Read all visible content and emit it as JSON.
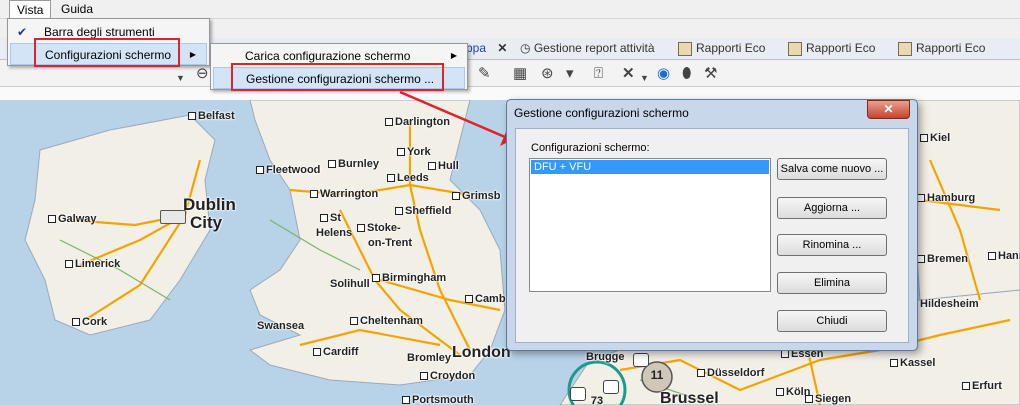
{
  "menubar": {
    "items": [
      "Vista",
      "Guida"
    ]
  },
  "vista_menu": {
    "items": [
      {
        "label": "Barra degli strumenti",
        "checked": true
      },
      {
        "label": "Configurazioni schermo",
        "has_submenu": true
      }
    ]
  },
  "submenu": {
    "items": [
      {
        "label": "Carica configurazione schermo",
        "has_submenu": true
      },
      {
        "label": "Gestione configurazioni schermo ..."
      }
    ]
  },
  "tabs": {
    "partial_label": "ppa",
    "report_label": "Gestione report attività",
    "eco1": "Rapporti Eco",
    "eco2": "Rapporti Eco",
    "eco3": "Rapporti Eco"
  },
  "dialog": {
    "title": "Gestione configurazioni schermo",
    "list_label": "Configurazioni schermo:",
    "configs": [
      "DFU + VFU"
    ],
    "buttons": {
      "save_new": "Salva come nuovo ...",
      "update": "Aggiorna ...",
      "rename": "Rinomina ...",
      "delete": "Elimina",
      "close": "Chiudi"
    }
  },
  "map": {
    "cities": [
      "Belfast",
      "Darlington",
      "Fleetwood",
      "Burnley",
      "York",
      "Hull",
      "Dublin",
      "City",
      "Warrington",
      "Leeds",
      "Grimsb",
      "Galway",
      "Sheffield",
      "St",
      "Helens",
      "Stoke-",
      "on-Trent",
      "Limerick",
      "Birmingham",
      "Solihull",
      "Camb",
      "Cork",
      "Swansea",
      "Cheltenham",
      "Cardiff",
      "Bromley",
      "London",
      "Croydon",
      "Portsmouth",
      "Brugge",
      "Essen",
      "Düsseldorf",
      "Kassel",
      "Brussel",
      "Köln",
      "Siegen",
      "Hamburg",
      "Bremen",
      "Hildesheim",
      "Hannover",
      "Kiel",
      "Erfurt"
    ],
    "markers": {
      "cluster_11": "11",
      "cluster_73": "73"
    }
  },
  "colors": {
    "water": "#b8d3e8",
    "land": "#f2efe6",
    "road": "#f4a400",
    "accent_red": "#e0222a",
    "selection": "#3399ff"
  }
}
